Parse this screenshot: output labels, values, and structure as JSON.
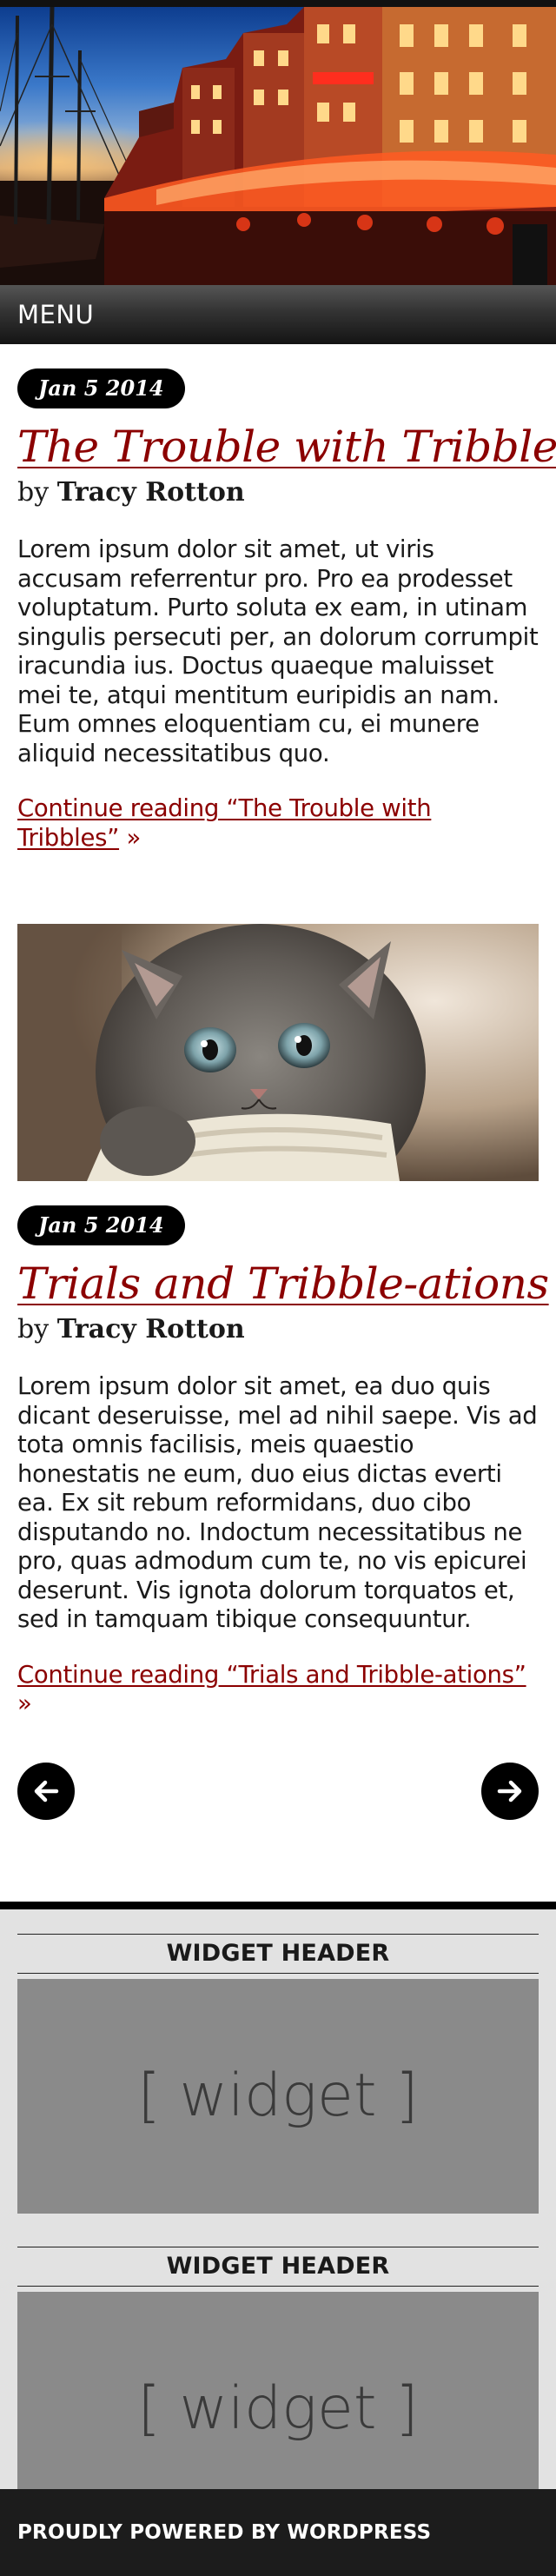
{
  "header": {
    "menu_label": "MENU"
  },
  "posts": [
    {
      "date": "Jan 5 2014",
      "title": "The Trouble with Tribbles",
      "by": "by",
      "author": "Tracy Rotton",
      "excerpt": "Lorem ipsum dolor sit amet, ut viris accusam referrentur pro. Pro ea prodesset voluptatum. Purto soluta ex eam, in utinam singulis persecuti per, an dolorum corrumpit iracundia ius. Doctus quaeque maluisset mei te, atqui mentitum euripidis an nam. Eum omnes eloquentiam cu, ei munere aliquid necessitatibus quo.",
      "continue_label": "Continue reading “The Trouble with Tribbles”",
      "raquo": "»"
    },
    {
      "date": "Jan 5 2014",
      "title": "Trials and Tribble-ations",
      "by": "by",
      "author": "Tracy Rotton",
      "excerpt": "Lorem ipsum dolor sit amet, ea duo quis dicant deseruisse, mel ad nihil saepe. Vis ad tota omnis facilisis, meis quaestio honestatis ne eum, duo eius dictas everti ea. Ex sit rebum reformidans, duo cibo disputando no. Indoctum necessitatibus ne pro, quas admodum cum te, no vis epicurei deserunt. Vis ignota dolorum torquatos et, sed in tamquam tibique consequuntur.",
      "continue_label": "Continue reading “Trials and Tribble-ations”",
      "raquo": "»"
    }
  ],
  "pagination": {
    "prev_icon": "arrow-left-icon",
    "next_icon": "arrow-right-icon"
  },
  "widgets": [
    {
      "header": "WIDGET HEADER",
      "content": "[ widget ]"
    },
    {
      "header": "WIDGET HEADER",
      "content": "[ widget ]"
    }
  ],
  "footer": {
    "text": "PROUDLY POWERED BY WORDPRESS"
  },
  "colors": {
    "link": "#8b0000",
    "badge": "#000000",
    "widget_bg": "#e2e2e2",
    "widget_box": "#8a8a8a",
    "footer_bg": "#1c1c1c"
  }
}
